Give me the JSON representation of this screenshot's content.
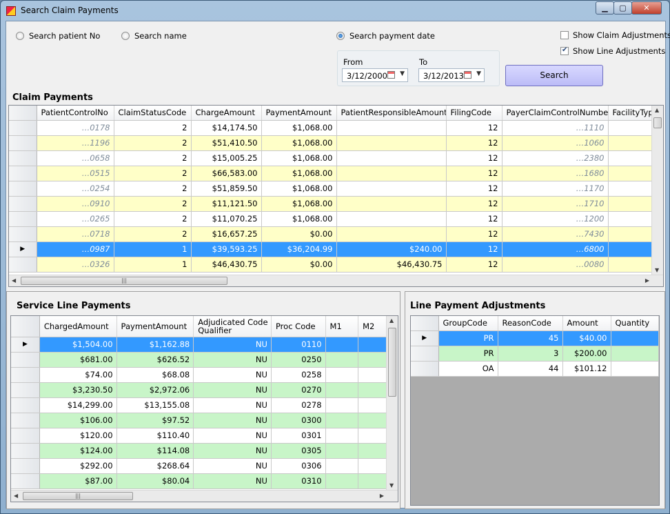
{
  "window": {
    "title": "Search Claim Payments",
    "minimize": "▁",
    "maximize": "▢",
    "close": "✕"
  },
  "search": {
    "patient_no_label": "Search patient No",
    "name_label": "Search name",
    "payment_date_label": "Search payment date",
    "selected": "payment_date",
    "from_label": "From",
    "to_label": "To",
    "from_value": "3/12/2000",
    "to_value": "3/12/2013",
    "show_claim_adjustments_label": "Show Claim Adjustments",
    "show_claim_adjustments_checked": false,
    "show_line_adjustments_label": "Show Line Adjustments",
    "show_line_adjustments_checked": true,
    "search_button": "Search"
  },
  "claim_payments": {
    "title": "Claim Payments",
    "columns": [
      "PatientControlNo",
      "ClaimStatusCode",
      "ChargeAmount",
      "PaymentAmount",
      "PatientResponsibleAmount",
      "FilingCode",
      "PayerClaimControlNumber",
      "FacilityType"
    ],
    "rows": [
      {
        "pcn": "…0178",
        "status": "2",
        "charge": "$14,174.50",
        "payment": "$1,068.00",
        "resp": "",
        "filing": "12",
        "payer": "…1110"
      },
      {
        "pcn": "…1196",
        "status": "2",
        "charge": "$51,410.50",
        "payment": "$1,068.00",
        "resp": "",
        "filing": "12",
        "payer": "…1060"
      },
      {
        "pcn": "…0658",
        "status": "2",
        "charge": "$15,005.25",
        "payment": "$1,068.00",
        "resp": "",
        "filing": "12",
        "payer": "…2380"
      },
      {
        "pcn": "…0515",
        "status": "2",
        "charge": "$66,583.00",
        "payment": "$1,068.00",
        "resp": "",
        "filing": "12",
        "payer": "…1680"
      },
      {
        "pcn": "…0254",
        "status": "2",
        "charge": "$51,859.50",
        "payment": "$1,068.00",
        "resp": "",
        "filing": "12",
        "payer": "…1170"
      },
      {
        "pcn": "…0910",
        "status": "2",
        "charge": "$11,121.50",
        "payment": "$1,068.00",
        "resp": "",
        "filing": "12",
        "payer": "…1710"
      },
      {
        "pcn": "…0265",
        "status": "2",
        "charge": "$11,070.25",
        "payment": "$1,068.00",
        "resp": "",
        "filing": "12",
        "payer": "…1200"
      },
      {
        "pcn": "…0718",
        "status": "2",
        "charge": "$16,657.25",
        "payment": "$0.00",
        "resp": "",
        "filing": "12",
        "payer": "…7430"
      },
      {
        "pcn": "…0987",
        "status": "1",
        "charge": "$39,593.25",
        "payment": "$36,204.99",
        "resp": "$240.00",
        "filing": "12",
        "payer": "…6800"
      },
      {
        "pcn": "…0326",
        "status": "1",
        "charge": "$46,430.75",
        "payment": "$0.00",
        "resp": "$46,430.75",
        "filing": "12",
        "payer": "…0080"
      }
    ],
    "selected_row": 8,
    "row_colors": [
      "#ffffff",
      "#ffffc8"
    ]
  },
  "service_lines": {
    "title": "Service Line Payments",
    "columns": [
      "ChargedAmount",
      "PaymentAmount",
      "Adjudicated Code Qualifier",
      "Proc Code",
      "M1",
      "M2"
    ],
    "rows": [
      {
        "charged": "$1,504.00",
        "payment": "$1,162.88",
        "qual": "NU",
        "proc": "0110"
      },
      {
        "charged": "$681.00",
        "payment": "$626.52",
        "qual": "NU",
        "proc": "0250"
      },
      {
        "charged": "$74.00",
        "payment": "$68.08",
        "qual": "NU",
        "proc": "0258"
      },
      {
        "charged": "$3,230.50",
        "payment": "$2,972.06",
        "qual": "NU",
        "proc": "0270"
      },
      {
        "charged": "$14,299.00",
        "payment": "$13,155.08",
        "qual": "NU",
        "proc": "0278"
      },
      {
        "charged": "$106.00",
        "payment": "$97.52",
        "qual": "NU",
        "proc": "0300"
      },
      {
        "charged": "$120.00",
        "payment": "$110.40",
        "qual": "NU",
        "proc": "0301"
      },
      {
        "charged": "$124.00",
        "payment": "$114.08",
        "qual": "NU",
        "proc": "0305"
      },
      {
        "charged": "$292.00",
        "payment": "$268.64",
        "qual": "NU",
        "proc": "0306"
      },
      {
        "charged": "$87.00",
        "payment": "$80.04",
        "qual": "NU",
        "proc": "0310"
      }
    ],
    "selected_row": 0,
    "row_colors": [
      "#ffffff",
      "#c8f5c8"
    ]
  },
  "line_adjustments": {
    "title": "Line Payment Adjustments",
    "columns": [
      "GroupCode",
      "ReasonCode",
      "Amount",
      "Quantity"
    ],
    "rows": [
      {
        "group": "PR",
        "reason": "45",
        "amount": "$40.00",
        "qty": ""
      },
      {
        "group": "PR",
        "reason": "3",
        "amount": "$200.00",
        "qty": ""
      },
      {
        "group": "OA",
        "reason": "44",
        "amount": "$101.12",
        "qty": ""
      }
    ],
    "selected_row": 0,
    "row_colors": [
      "#ffffff",
      "#c8f5c8"
    ]
  },
  "colors": {
    "selection": "#3399ff",
    "search_button": "#c8c8fa"
  }
}
